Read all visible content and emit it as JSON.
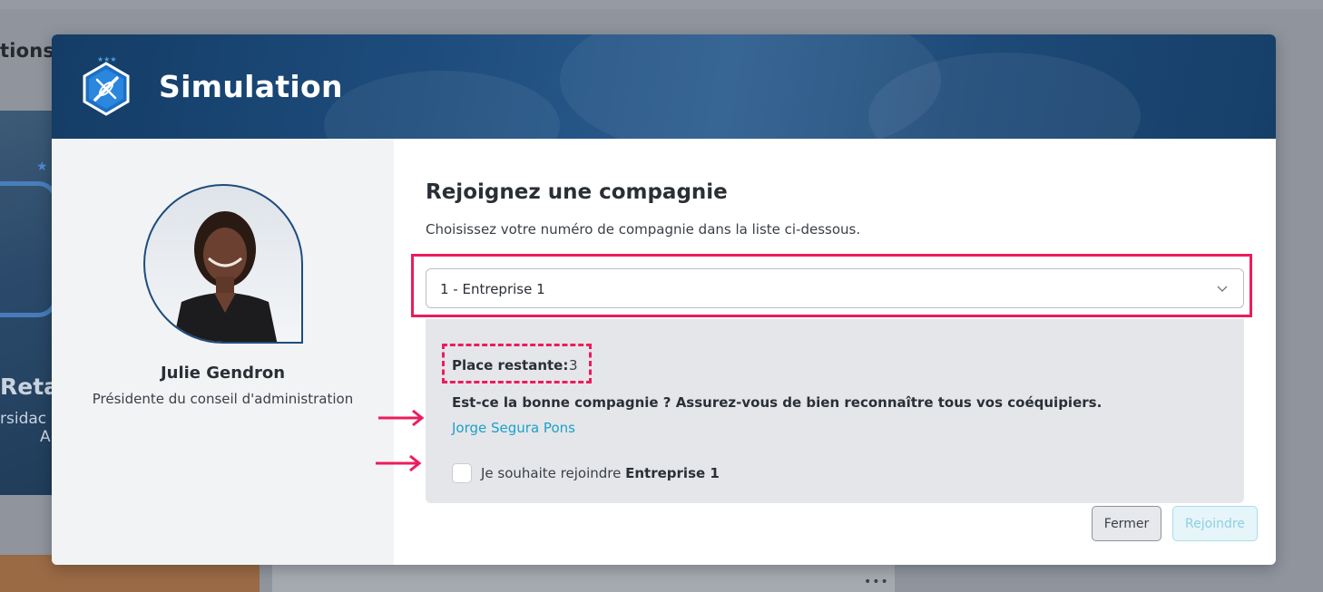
{
  "background": {
    "partial_title": "tions",
    "card_title_fragment": "Reta",
    "card_sub_fragment1": "rsidac",
    "card_sub_fragment2": "A",
    "dots": "•••"
  },
  "modal": {
    "title": "Simulation",
    "logo_icon": "kayak-badge-icon"
  },
  "profile": {
    "name": "Julie Gendron",
    "role": "Présidente du conseil d'administration"
  },
  "join": {
    "heading": "Rejoignez une compagnie",
    "instruction": "Choisissez votre numéro de compagnie dans la liste ci-dessous.",
    "select_value": "1 - Entreprise 1",
    "remaining_label": "Place restante",
    "remaining_value": "3",
    "question": "Est-ce la bonne compagnie ? Assurez-vous de bien reconnaître tous vos coéquipiers.",
    "teammates": [
      "Jorge Segura Pons"
    ],
    "checkbox_prefix": "Je souhaite rejoindre",
    "checkbox_company": "Entreprise 1",
    "checked": false
  },
  "buttons": {
    "close": "Fermer",
    "join": "Rejoindre"
  },
  "colors": {
    "highlight": "#ec1c5c",
    "header_blue": "#1d4c7c",
    "link": "#1aa2c8"
  }
}
